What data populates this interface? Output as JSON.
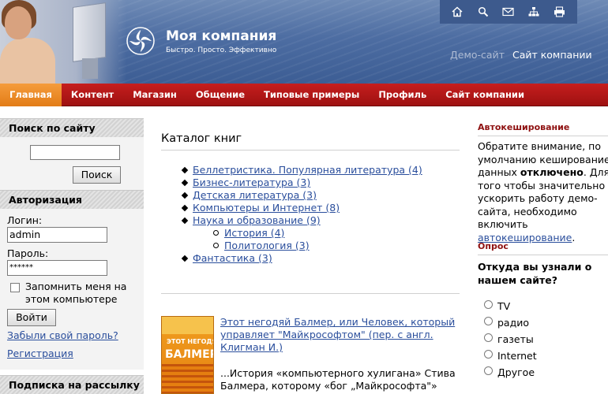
{
  "header": {
    "title": "Моя компания",
    "slogan": "Быстро. Просто. Эффективно",
    "demo_site": "Демо-сайт",
    "company_site": "Сайт компании",
    "top_icons": [
      "home-icon",
      "search-icon",
      "mail-icon",
      "sitemap-icon",
      "print-icon"
    ]
  },
  "nav": {
    "items": [
      {
        "label": "Главная",
        "active": true
      },
      {
        "label": "Контент"
      },
      {
        "label": "Магазин"
      },
      {
        "label": "Общение"
      },
      {
        "label": "Типовые примеры"
      },
      {
        "label": "Профиль"
      },
      {
        "label": "Сайт компании"
      }
    ]
  },
  "sidebar": {
    "search_title": "Поиск по сайту",
    "search_value": "",
    "search_button": "Поиск",
    "auth_title": "Авторизация",
    "login_label": "Логин:",
    "login_value": "admin",
    "password_label": "Пароль:",
    "password_value": "******",
    "remember_label": "Запомнить меня на этом компьютере",
    "login_button": "Войти",
    "forgot_link": "Забыли свой пароль?",
    "register_link": "Регистрация",
    "subscribe_title": "Подписка на рассылку"
  },
  "main": {
    "title": "Каталог книг",
    "categories": [
      {
        "label": "Беллетристика. Популярная литература (4)"
      },
      {
        "label": "Бизнес-литература (3)"
      },
      {
        "label": "Детская литература (3)"
      },
      {
        "label": "Компьютеры и Интернет (8)"
      },
      {
        "label": "Наука и образование (9)"
      },
      {
        "label": "История (4)",
        "sub": true
      },
      {
        "label": "Политология (3)",
        "sub": true
      },
      {
        "label": "Фантастика (3)"
      }
    ],
    "book": {
      "cover_line1": "ЭТОТ НЕГОДЯЙ",
      "cover_line2": "БАЛМЕР",
      "link": "Этот негодяй Балмер, или Человек, который управляет \"Майкрософтом\" (пер. с англ. Клигман И.)",
      "desc": "...История «компьютерного хулигана» Стива Балмера, которому «бог „Майкрософта\"» Билл"
    }
  },
  "right": {
    "cache_title": "Автокеширование",
    "cache_text_1": "Обратите внимание, по умолчанию кеширование данных ",
    "cache_text_bold": "отключено",
    "cache_text_2": ". Для того чтобы значительно ускорить работу демо-сайта, необходимо включить ",
    "cache_link": "автокеширование",
    "cache_text_3": ".",
    "poll_title": "Опрос",
    "poll_question": "Откуда вы узнали о нашем сайте?",
    "poll_options": [
      "TV",
      "радио",
      "газеты",
      "Internet",
      "Другое"
    ]
  }
}
